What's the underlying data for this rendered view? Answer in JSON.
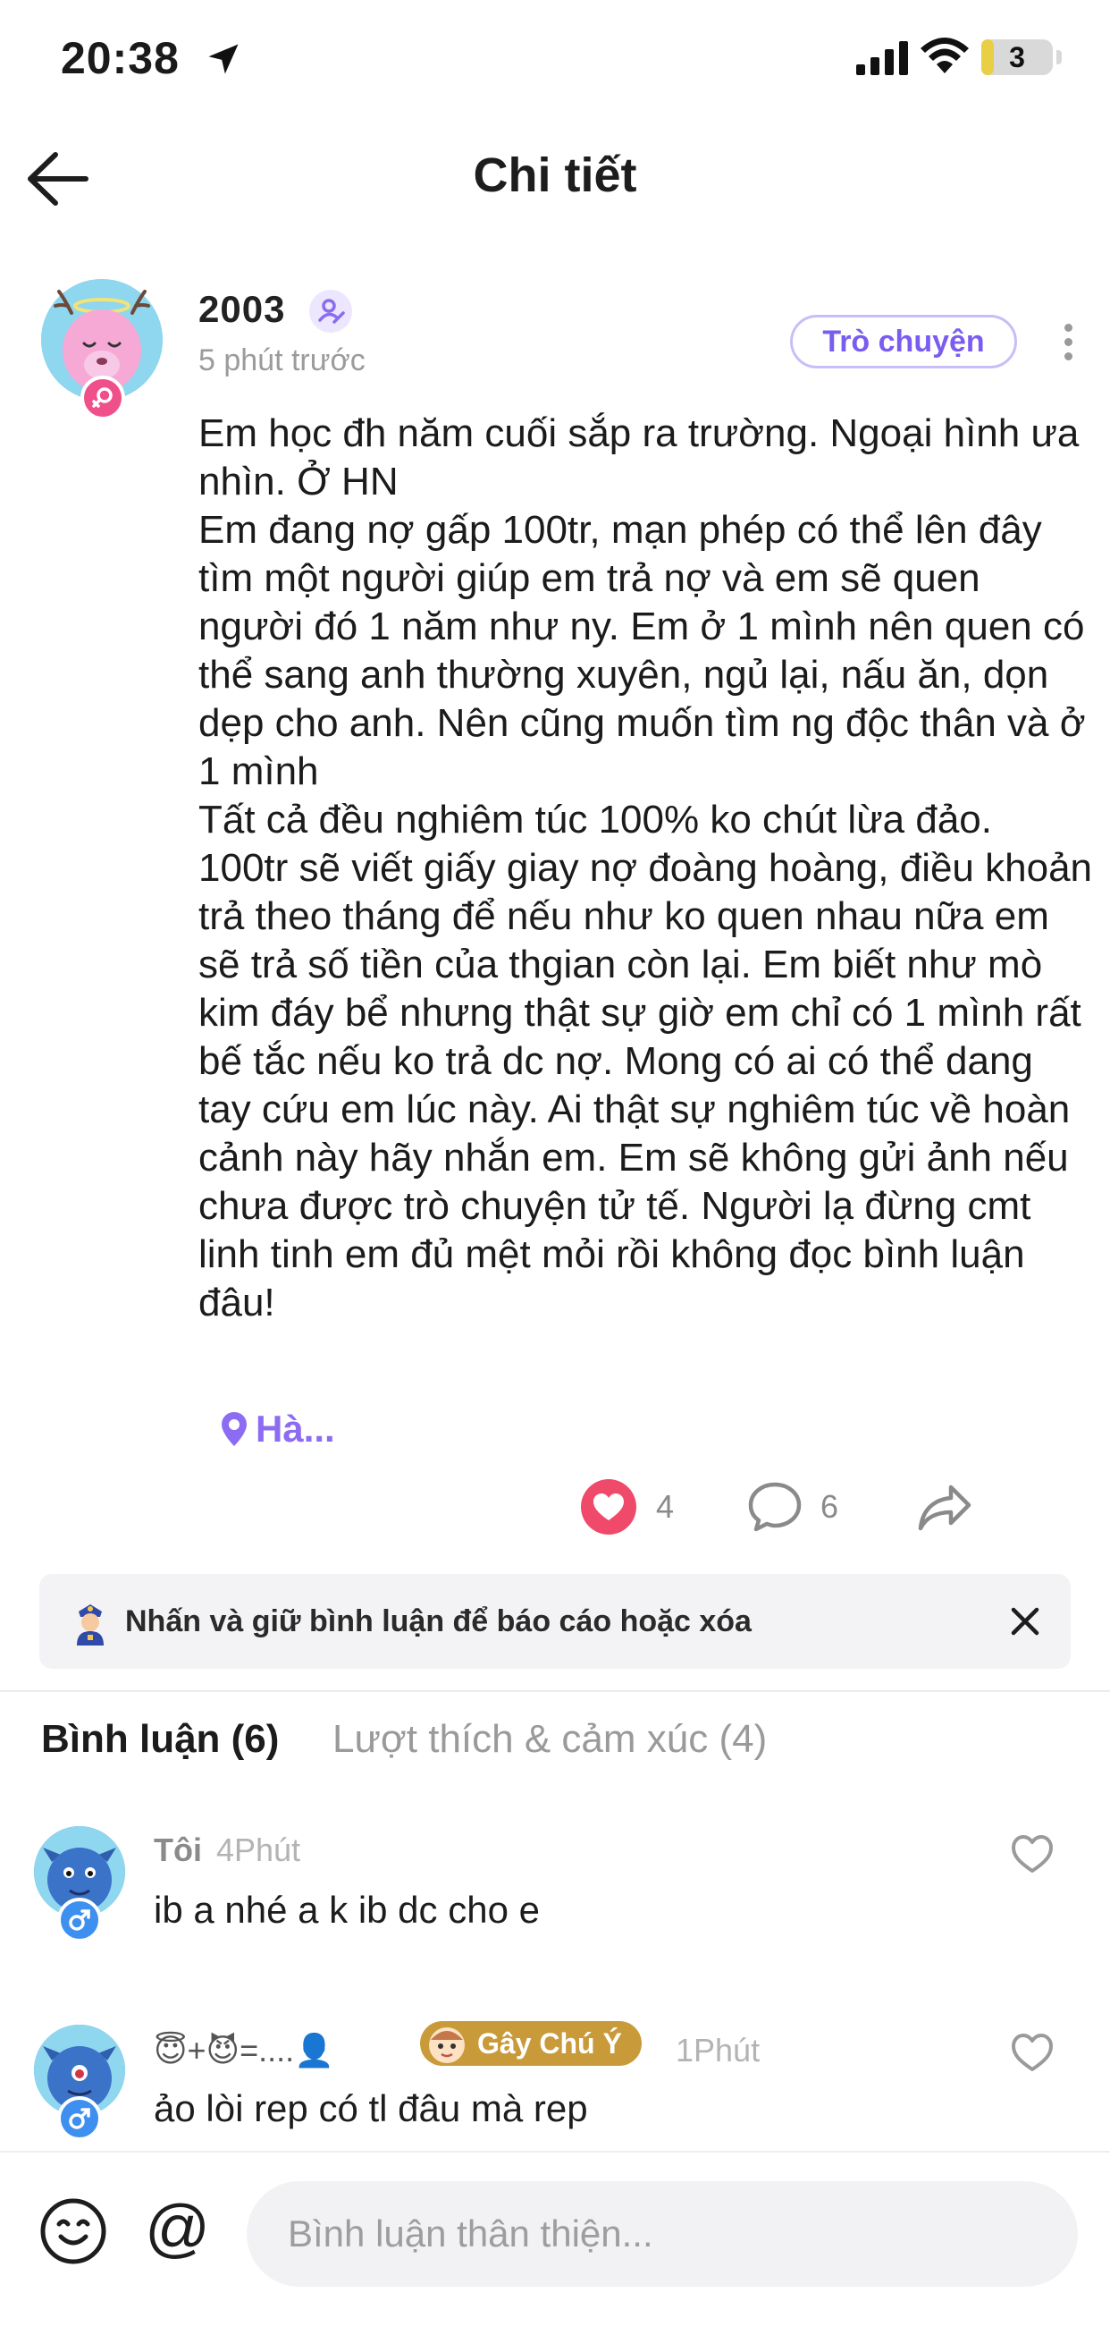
{
  "status_bar": {
    "time": "20:38",
    "battery_percent": "3",
    "battery_level": 0.03
  },
  "nav": {
    "title": "Chi tiết"
  },
  "post": {
    "username": "2003",
    "time_ago": "5 phút trước",
    "chat_button": "Trò chuyện",
    "body": [
      "Em học đh năm cuối sắp ra trường. Ngoại hình ưa nhìn. Ở HN",
      "Em đang nợ gấp 100tr, mạn phép có thể lên đây tìm một người giúp em trả nợ và em sẽ quen người đó 1 năm như ny. Em ở 1 mình nên quen có thể sang anh thường xuyên, ngủ lại, nấu ăn, dọn dẹp cho anh. Nên cũng muốn tìm ng độc thân và ở 1 mình",
      "Tất cả đều nghiêm túc 100% ko chút lừa đảo. 100tr sẽ viết giấy giay nợ đoàng hoàng, điều khoản trả theo tháng để nếu như ko quen nhau nữa em sẽ trả số tiền của thgian còn lại. Em biết như mò kim đáy bể nhưng thật sự giờ em chỉ có 1 mình rất bế tắc nếu ko trả dc nợ. Mong có ai có thể dang tay cứu em lúc này. Ai thật sự nghiêm túc về hoàn cảnh này hãy nhắn em. Em sẽ không gửi ảnh nếu chưa được trò chuyện tử tế. Người lạ đừng cmt linh tinh em đủ mệt mỏi rồi không đọc bình luận đâu!"
    ],
    "location": "Hà...",
    "like_count": "4",
    "comment_count": "6"
  },
  "tip": {
    "text": "Nhấn và giữ bình luận để báo cáo hoặc xóa"
  },
  "tabs": {
    "comments": "Bình luận (6)",
    "reactions": "Lượt thích & cảm xúc (4)"
  },
  "comments": [
    {
      "name": "Tôi",
      "time": "4Phút",
      "text": "ib a nhé a k ib dc cho e"
    },
    {
      "name": "😇+😈=....👤",
      "badge": "Gây Chú Ý",
      "time": "1Phút",
      "text": "ảo lòi rep có tl đâu mà rep"
    }
  ],
  "composer": {
    "placeholder": "Bình luận thân thiện...",
    "at_symbol": "@"
  },
  "colors": {
    "accent": "#7a5cf0",
    "like": "#ef4a6a",
    "female_badge": "#f0508a",
    "male_badge": "#3d8ff0"
  }
}
